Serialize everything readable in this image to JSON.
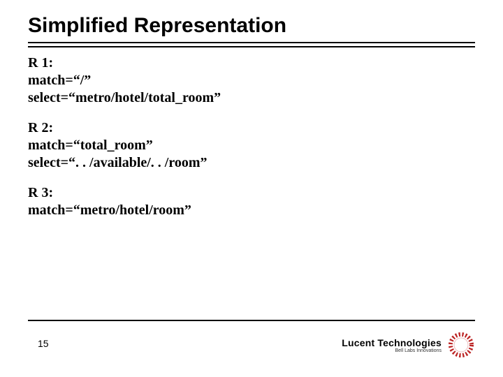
{
  "title": "Simplified Representation",
  "rules": [
    {
      "label": "R 1:",
      "match": "match=“/”",
      "select": "select=“metro/hotel/total_room”"
    },
    {
      "label": "R 2:",
      "match": "match=“total_room”",
      "select": "select=“. . /available/. . /room”"
    },
    {
      "label": "R 3:",
      "match": "match=“metro/hotel/room”",
      "select": ""
    }
  ],
  "page_number": "15",
  "brand": {
    "name": "Lucent Technologies",
    "tagline": "Bell Labs Innovations"
  }
}
